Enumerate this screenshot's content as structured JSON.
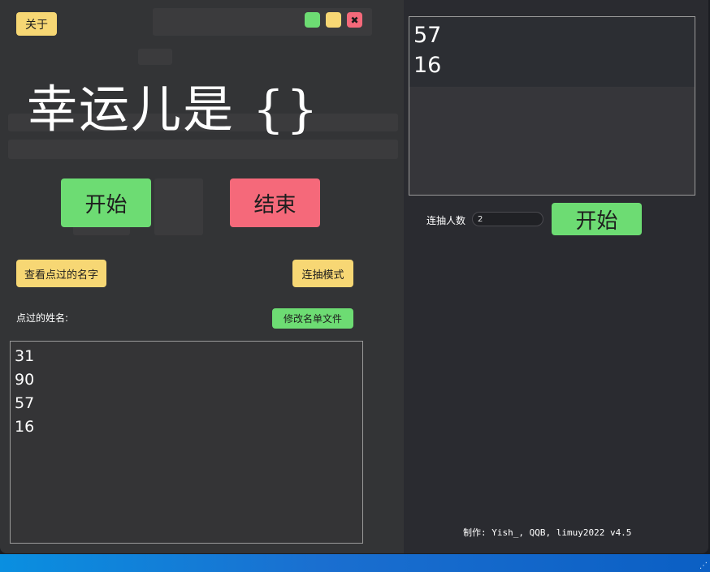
{
  "window": {
    "about_label": "关于",
    "controls": {
      "minimize_color": "#6ddc73",
      "maximize_color": "#f7d774",
      "close_color": "#f5697a",
      "close_glyph": "✖"
    }
  },
  "main": {
    "title": "幸运儿是 {}",
    "start_label": "开始",
    "stop_label": "结束",
    "view_called_label": "查看点过的名字",
    "batch_mode_label": "连抽模式",
    "called_names_label": "点过的姓名:",
    "edit_list_label": "修改名单文件",
    "called_names": [
      "31",
      "90",
      "57",
      "16"
    ]
  },
  "batch": {
    "results": [
      "57",
      "16"
    ],
    "count_label": "连抽人数",
    "count_value": "2",
    "start_label": "开始"
  },
  "footer": {
    "credit": "制作: Yish_, QQB, limuy2022  v4.5"
  },
  "colors": {
    "accent_yellow": "#f7d774",
    "accent_green": "#6ddc73",
    "accent_red": "#f5697a",
    "panel_bg": "#333436"
  }
}
